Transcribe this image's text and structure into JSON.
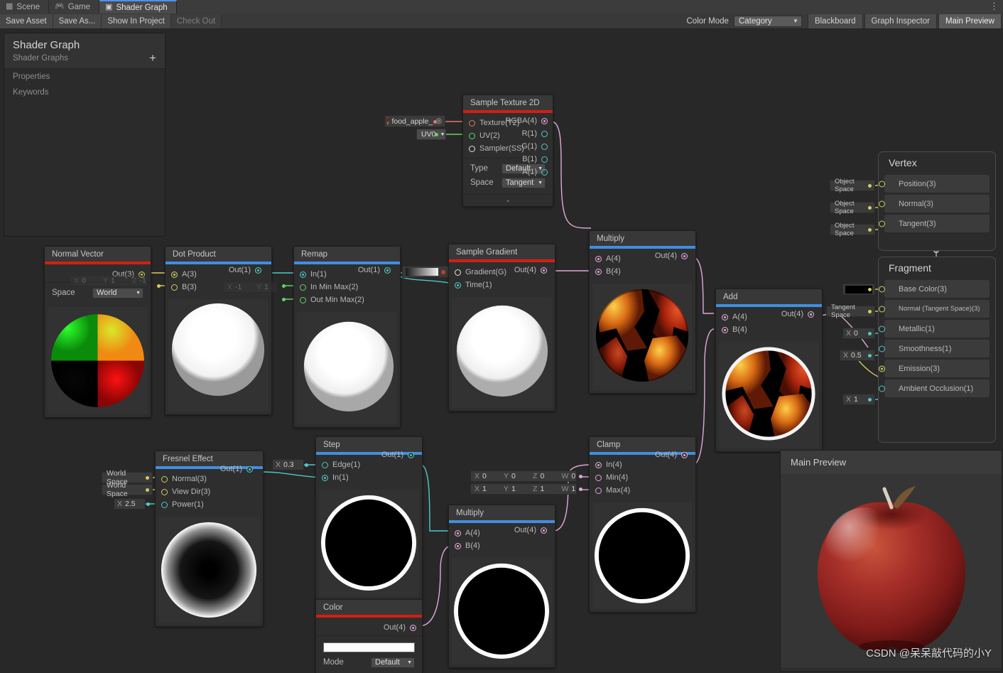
{
  "window": {
    "tabs": [
      {
        "label": "Scene",
        "icon": "grid-icon",
        "active": false
      },
      {
        "label": "Game",
        "icon": "gamepad-icon",
        "active": false
      },
      {
        "label": "Shader Graph",
        "icon": "shader-graph-icon",
        "active": true
      }
    ],
    "menu_glyph": "⋮"
  },
  "toolbar": {
    "save_asset": "Save Asset",
    "save_as": "Save As...",
    "show_in_project": "Show In Project",
    "check_out": "Check Out",
    "color_mode_label": "Color Mode",
    "color_mode_value": "Category",
    "blackboard": "Blackboard",
    "graph_inspector": "Graph Inspector",
    "main_preview": "Main Preview",
    "caret": "▼"
  },
  "blackboard": {
    "title": "Shader Graph",
    "subtitle": "Shader Graphs",
    "add_label": "+",
    "sections": [
      "Properties",
      "Keywords"
    ]
  },
  "colors": {
    "accent_red": "#d21f12",
    "accent_blue": "#3f8fe0",
    "tab_highlight": "#4f8ff7",
    "wire_yellow": "#cfcf5e",
    "wire_cyan": "#51c7c7",
    "wire_pink": "#e0a8d8",
    "wire_red": "#e2756e",
    "wire_green": "#63d463",
    "node_bg": "#2e2e2e",
    "canvas_bg": "#282828"
  },
  "nodes": {
    "sample_texture_2d": {
      "title": "Sample Texture 2D",
      "accent": "red",
      "inputs": [
        "Texture(T2)",
        "UV(2)",
        "Sampler(SS)"
      ],
      "outputs": [
        "RGBA(4)",
        "R(1)",
        "G(1)",
        "B(1)",
        "A(1)"
      ],
      "props": [
        {
          "label": "Type",
          "value": "Default"
        },
        {
          "label": "Space",
          "value": "Tangent"
        }
      ],
      "texture_field": "food_apple_",
      "uv_field": "UV0",
      "expander": "⌄"
    },
    "normal_vector": {
      "title": "Normal Vector",
      "accent": "red",
      "outputs": [
        "Out(3)"
      ],
      "props": [
        {
          "label": "Space",
          "value": "World"
        }
      ],
      "hidden_vector": {
        "x": "0",
        "y": "1",
        "z": "-1"
      }
    },
    "dot_product": {
      "title": "Dot Product",
      "accent": "blue",
      "inputs": [
        "A(3)",
        "B(3)"
      ],
      "outputs": [
        "Out(1)"
      ],
      "b_vector": {
        "x": "-1",
        "y": "1"
      }
    },
    "remap": {
      "title": "Remap",
      "accent": "blue",
      "inputs": [
        "In(1)",
        "In Min Max(2)",
        "Out Min Max(2)"
      ],
      "outputs": [
        "Out(1)"
      ]
    },
    "sample_gradient": {
      "title": "Sample Gradient",
      "accent": "red",
      "inputs": [
        "Gradient(G)",
        "Time(1)"
      ],
      "outputs": [
        "Out(4)"
      ]
    },
    "multiply_top": {
      "title": "Multiply",
      "accent": "blue",
      "inputs": [
        "A(4)",
        "B(4)"
      ],
      "outputs": [
        "Out(4)"
      ]
    },
    "add": {
      "title": "Add",
      "accent": "blue",
      "inputs": [
        "A(4)",
        "B(4)"
      ],
      "outputs": [
        "Out(4)"
      ]
    },
    "fresnel_effect": {
      "title": "Fresnel Effect",
      "accent": "blue",
      "inputs": [
        "Normal(3)",
        "View Dir(3)",
        "Power(1)"
      ],
      "outputs": [
        "Out(1)"
      ],
      "normal_space": "World Space",
      "viewdir_space": "World Space",
      "power_key": "X",
      "power_value": "2.5"
    },
    "step": {
      "title": "Step",
      "accent": "blue",
      "inputs": [
        "Edge(1)",
        "In(1)"
      ],
      "outputs": [
        "Out(1)"
      ],
      "edge_key": "X",
      "edge_value": "0.3"
    },
    "color": {
      "title": "Color",
      "accent": "red",
      "outputs": [
        "Out(4)"
      ],
      "swatch": "#ffffff",
      "mode_label": "Mode",
      "mode_value": "Default"
    },
    "multiply_bottom": {
      "title": "Multiply",
      "accent": "blue",
      "inputs": [
        "A(4)",
        "B(4)"
      ],
      "outputs": [
        "Out(4)"
      ]
    },
    "clamp": {
      "title": "Clamp",
      "accent": "blue",
      "inputs": [
        "In(4)",
        "Min(4)",
        "Max(4)"
      ],
      "outputs": [
        "Out(4)"
      ],
      "min_vector": {
        "x": "0",
        "y": "0",
        "z": "0",
        "w": "0"
      },
      "max_vector": {
        "x": "1",
        "y": "1",
        "z": "1",
        "w": "1"
      },
      "keys": {
        "x": "X",
        "y": "Y",
        "z": "Z",
        "w": "W"
      }
    }
  },
  "master_stack": {
    "vertex": {
      "title": "Vertex",
      "blocks": [
        {
          "label": "Position(3)",
          "source": "Object Space"
        },
        {
          "label": "Normal(3)",
          "source": "Object Space"
        },
        {
          "label": "Tangent(3)",
          "source": "Object Space"
        }
      ]
    },
    "fragment": {
      "title": "Fragment",
      "blocks": [
        {
          "label": "Base Color(3)",
          "source": "swatch",
          "swatch": "#000000"
        },
        {
          "label": "Normal (Tangent Space)(3)",
          "source": "Tangent Space"
        },
        {
          "label": "Metallic(1)",
          "source": "field",
          "key": "X",
          "value": "0"
        },
        {
          "label": "Smoothness(1)",
          "source": "field",
          "key": "X",
          "value": "0.5"
        },
        {
          "label": "Emission(3)",
          "source": "connected"
        },
        {
          "label": "Ambient Occlusion(1)",
          "source": "field",
          "key": "X",
          "value": "1"
        }
      ]
    }
  },
  "main_preview": {
    "title": "Main Preview",
    "watermark": "CSDN @呆呆敲代码的小Y"
  }
}
